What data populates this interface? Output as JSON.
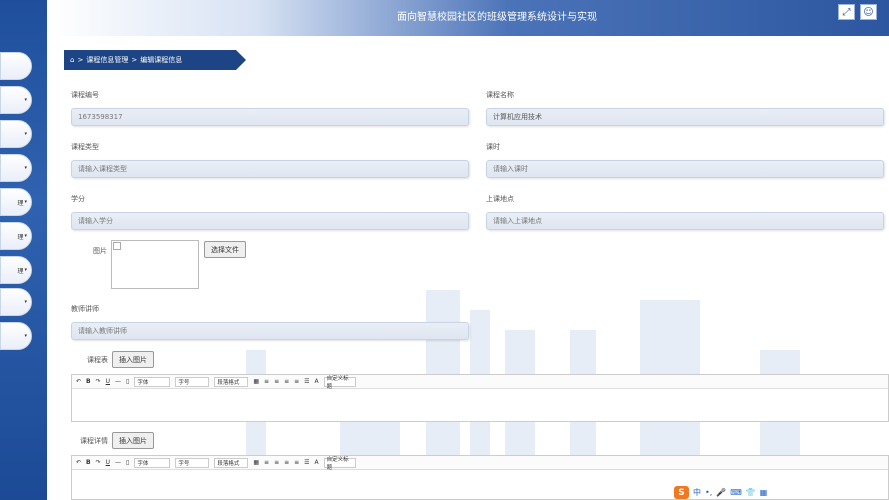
{
  "header": {
    "title": "面向智慧校园社区的班级管理系统设计与实现"
  },
  "header_icons": [
    "fullscreen-icon",
    "user-icon"
  ],
  "left_nav": {
    "items": [
      {
        "label": "",
        "arrow": ""
      },
      {
        "label": "",
        "arrow": "▾"
      },
      {
        "label": "",
        "arrow": "▾"
      },
      {
        "label": "",
        "arrow": "▾"
      },
      {
        "label": "理",
        "arrow": "▾"
      },
      {
        "label": "理",
        "arrow": "▾"
      },
      {
        "label": "理",
        "arrow": "▾"
      },
      {
        "label": "",
        "arrow": "▾"
      },
      {
        "label": "",
        "arrow": "▾"
      }
    ]
  },
  "breadcrumb": {
    "home_icon": "home-icon",
    "sep": ">",
    "item1": "课程信息管理",
    "item2": "编辑课程信息"
  },
  "form": {
    "course_no_label": "课程编号",
    "course_no_value": "1673598317",
    "course_name_label": "课程名称",
    "course_name_value": "计算机应用技术",
    "course_type_label": "课程类型",
    "course_type_placeholder": "请输入课程类型",
    "hours_label": "课时",
    "hours_placeholder": "请输入课时",
    "credit_label": "学分",
    "credit_placeholder": "请输入学分",
    "location_label": "上课地点",
    "location_placeholder": "请输入上课地点",
    "image_label": "图片",
    "choose_file_label": "选择文件",
    "teacher_label": "教师讲师",
    "teacher_placeholder": "请输入教师讲师",
    "schedule_label": "课程表",
    "insert_image_1": "插入图片",
    "detail_label": "课程详情",
    "insert_image_2": "插入图片"
  },
  "editor_toolbar": {
    "font": "字体",
    "size": "字号",
    "paragraph": "段落格式",
    "custom_title": "自定义标题"
  },
  "ime": {
    "logo": "S",
    "lang": "中"
  }
}
